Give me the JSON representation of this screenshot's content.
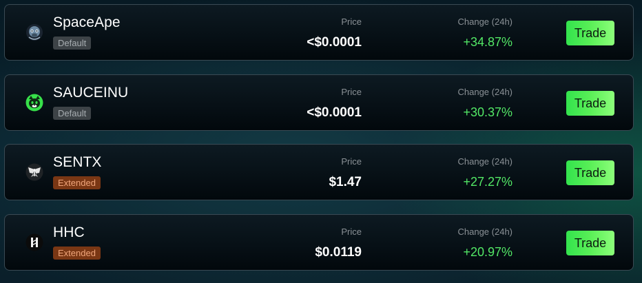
{
  "headers": {
    "price": "Price",
    "change": "Change (24h)"
  },
  "tokens": [
    {
      "name": "SpaceApe",
      "badge": "Default",
      "price": "<$0.0001",
      "change": "+34.87%",
      "icon": "ape-icon",
      "trade": "Trade"
    },
    {
      "name": "SAUCEINU",
      "badge": "Default",
      "price": "<$0.0001",
      "change": "+30.37%",
      "icon": "cat-icon",
      "trade": "Trade"
    },
    {
      "name": "SENTX",
      "badge": "Extended",
      "price": "$1.47",
      "change": "+27.27%",
      "icon": "moth-icon",
      "trade": "Trade"
    },
    {
      "name": "HHC",
      "badge": "Extended",
      "price": "$0.0119",
      "change": "+20.97%",
      "icon": "hhc-logo-icon",
      "trade": "Trade"
    }
  ],
  "colors": {
    "accent_green": "#53e866",
    "badge_default_bg": "#3d4347",
    "badge_extended_bg": "#7a3714"
  }
}
